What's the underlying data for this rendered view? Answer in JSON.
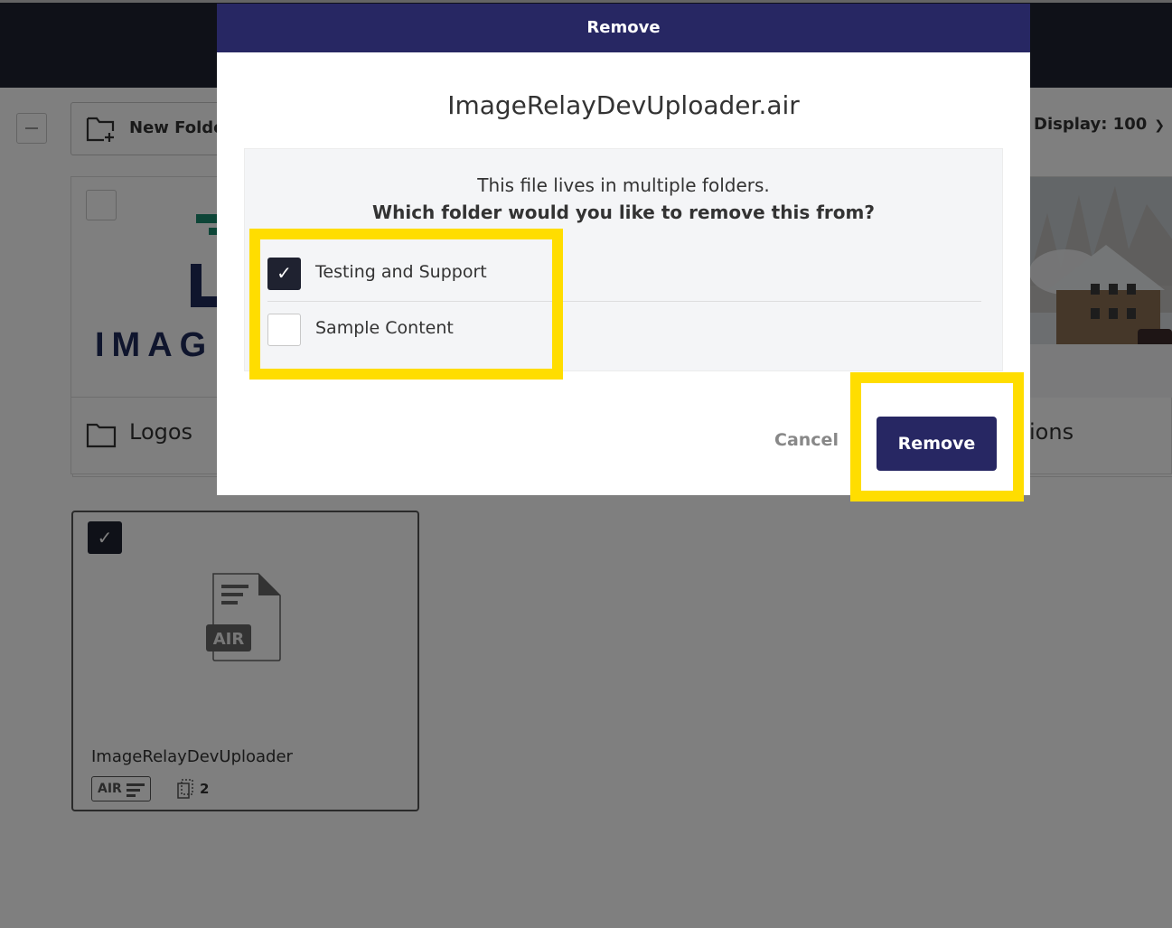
{
  "toolbar": {
    "new_folder_label": "New Folder",
    "display_label": "Display: 100"
  },
  "folders": [
    {
      "name": "Logos",
      "logo_text": "IMAG"
    },
    {
      "name": "ions"
    }
  ],
  "file_card": {
    "type_label": "AIR",
    "name": "ImageRelayDevUploader",
    "badge_type": "AIR",
    "copies_count": "2",
    "selected": true
  },
  "modal": {
    "title": "Remove",
    "filename": "ImageRelayDevUploader.air",
    "message": "This file lives in multiple folders.",
    "question": "Which folder would you like to remove this from?",
    "options": [
      {
        "label": "Testing and Support",
        "checked": true
      },
      {
        "label": "Sample Content",
        "checked": false
      }
    ],
    "cancel_label": "Cancel",
    "remove_label": "Remove"
  },
  "colors": {
    "modal_header": "#272763",
    "primary_button": "#272763",
    "highlight": "#ffdd00",
    "topbar": "#1f2230"
  }
}
